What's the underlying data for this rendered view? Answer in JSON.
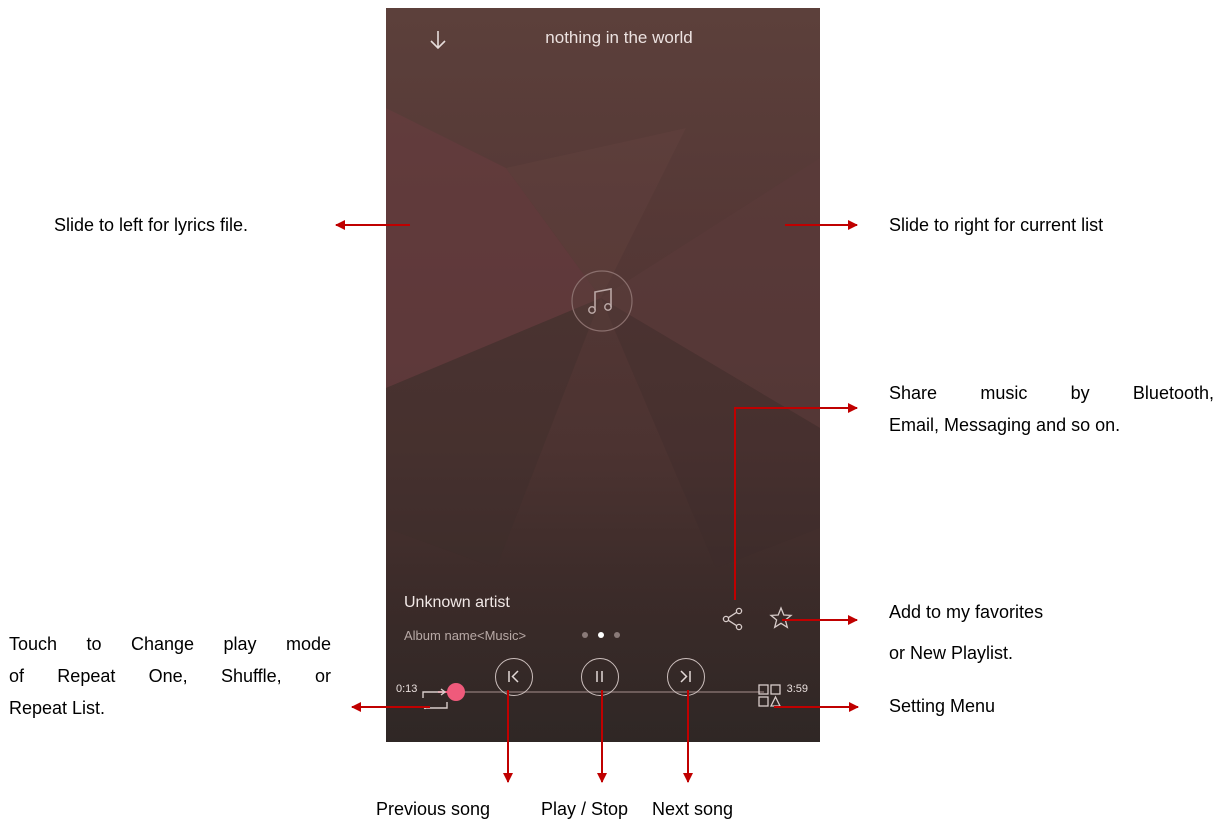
{
  "player": {
    "title": "nothing in the world",
    "artist": "Unknown artist",
    "album": "Album name<Music>",
    "time_current": "0:13",
    "time_total": "3:59",
    "progress_fraction": 0.055,
    "page_indicator": {
      "count": 3,
      "active_index": 1
    },
    "accent_color": "#ec4f73",
    "icons": {
      "back": "arrow-down-icon",
      "cover": "music-note-icon",
      "share": "share-icon",
      "favorite": "star-icon",
      "play_mode": "repeat-icon",
      "previous": "previous-icon",
      "play_pause": "pause-icon",
      "next": "next-icon",
      "menu": "grid-menu-icon"
    }
  },
  "annotations": {
    "slide_left": "Slide to left for lyrics file.",
    "slide_right": "Slide to right for current list",
    "share_line1": "Share music by Bluetooth,",
    "share_line2": "Email, Messaging and so on.",
    "favorites_line1": "Add to my favorites",
    "favorites_line2": "or New Playlist.",
    "play_mode_line1": "Touch to Change play mode",
    "play_mode_line2": "of Repeat One, Shuffle, or",
    "play_mode_line3": "Repeat List.",
    "setting_menu": "Setting Menu",
    "previous_song": "Previous song",
    "play_stop": "Play / Stop",
    "next_song": "Next song",
    "arrow_color": "#c00000"
  }
}
